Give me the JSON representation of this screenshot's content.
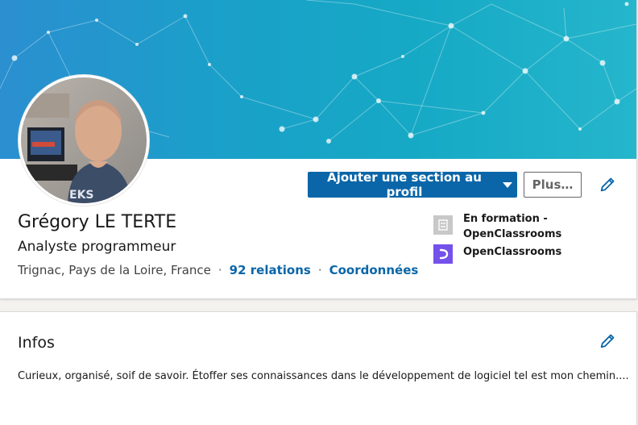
{
  "profile": {
    "name": "Grégory LE TERTE",
    "headline": "Analyste programmeur",
    "location": "Trignac, Pays de la Loire, France",
    "separator": "·",
    "relations": "92 relations",
    "contact_info": "Coordonnées",
    "avatar_icon": "profile-photo"
  },
  "actions": {
    "add_section": "Ajouter une section au profil",
    "more": "Plus…",
    "edit_icon": "pencil-icon"
  },
  "experience": [
    {
      "label": "En formation - OpenClassrooms",
      "icon": "building-icon"
    },
    {
      "label": "OpenClassrooms",
      "icon": "openclassrooms-logo"
    }
  ],
  "about": {
    "title": "Infos",
    "text": "Curieux, organisé, soif de savoir. Étoffer ses connaissances dans le développement de logiciel tel est mon chemin...."
  },
  "colors": {
    "primary": "#0a66a8",
    "banner_start": "#2b8fd0",
    "banner_end": "#25b6cc",
    "openclassrooms": "#7451eb"
  }
}
